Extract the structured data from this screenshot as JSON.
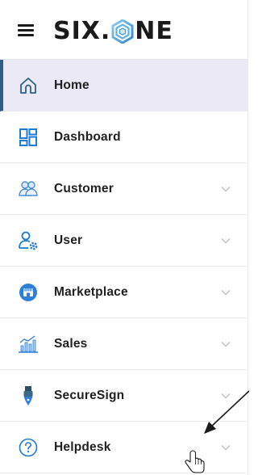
{
  "app": {
    "logo_left": "SIX.",
    "logo_right": "NE"
  },
  "colors": {
    "accent": "#2f5f84",
    "active_bg": "#ebe9f6",
    "icon_blue": "#1d7bd3",
    "chevron": "#c8c8cf"
  },
  "sidebar": {
    "items": [
      {
        "label": "Home",
        "icon": "home-icon",
        "active": true,
        "has_chevron": false
      },
      {
        "label": "Dashboard",
        "icon": "dashboard-icon",
        "active": false,
        "has_chevron": false
      },
      {
        "label": "Customer",
        "icon": "customers-icon",
        "active": false,
        "has_chevron": true
      },
      {
        "label": "User",
        "icon": "user-settings-icon",
        "active": false,
        "has_chevron": true
      },
      {
        "label": "Marketplace",
        "icon": "marketplace-icon",
        "active": false,
        "has_chevron": true
      },
      {
        "label": "Sales",
        "icon": "sales-chart-icon",
        "active": false,
        "has_chevron": true
      },
      {
        "label": "SecureSign",
        "icon": "pen-nib-icon",
        "active": false,
        "has_chevron": true
      },
      {
        "label": "Helpdesk",
        "icon": "help-circle-icon",
        "active": false,
        "has_chevron": true
      }
    ]
  }
}
